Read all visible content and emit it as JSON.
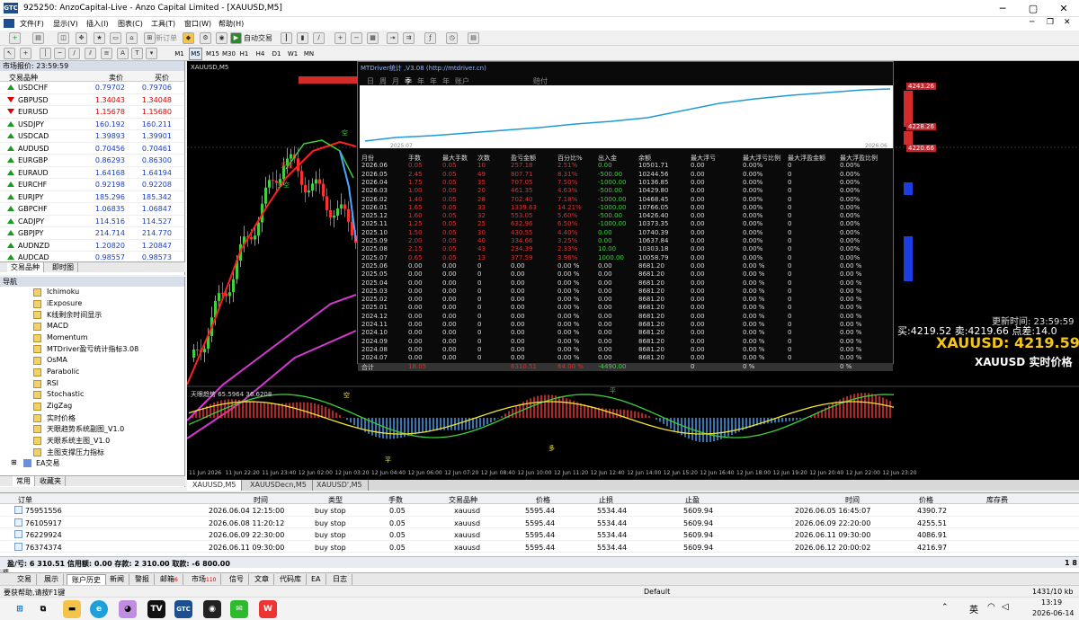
{
  "window": {
    "title": "925250: AnzoCapital-Live - Anzo Capital Limited - [XAUUSD,M5]",
    "logo": "GTC"
  },
  "menu": [
    "文件(F)",
    "显示(V)",
    "插入(I)",
    "图表(C)",
    "工具(T)",
    "窗口(W)",
    "帮助(H)"
  ],
  "toolbar": {
    "new_order": "新订单",
    "auto_trade": "自动交易"
  },
  "timeframes": [
    "M1",
    "M5",
    "M15",
    "M30",
    "H1",
    "H4",
    "D1",
    "W1",
    "MN"
  ],
  "market_watch": {
    "header": "市场报价: 23:59:59",
    "columns": [
      "交易品种",
      "卖价",
      "买价"
    ],
    "rows": [
      {
        "symbol": "USDCHF",
        "bid": "0.79702",
        "ask": "0.79706",
        "dir": "up"
      },
      {
        "symbol": "GBPUSD",
        "bid": "1.34043",
        "ask": "1.34048",
        "dir": "dn"
      },
      {
        "symbol": "EURUSD",
        "bid": "1.15678",
        "ask": "1.15680",
        "dir": "dn"
      },
      {
        "symbol": "USDJPY",
        "bid": "160.192",
        "ask": "160.211",
        "dir": "up"
      },
      {
        "symbol": "USDCAD",
        "bid": "1.39893",
        "ask": "1.39901",
        "dir": "up"
      },
      {
        "symbol": "AUDUSD",
        "bid": "0.70456",
        "ask": "0.70461",
        "dir": "up"
      },
      {
        "symbol": "EURGBP",
        "bid": "0.86293",
        "ask": "0.86300",
        "dir": "up"
      },
      {
        "symbol": "EURAUD",
        "bid": "1.64168",
        "ask": "1.64194",
        "dir": "up"
      },
      {
        "symbol": "EURCHF",
        "bid": "0.92198",
        "ask": "0.92208",
        "dir": "up"
      },
      {
        "symbol": "EURJPY",
        "bid": "185.296",
        "ask": "185.342",
        "dir": "up"
      },
      {
        "symbol": "GBPCHF",
        "bid": "1.06835",
        "ask": "1.06847",
        "dir": "up"
      },
      {
        "symbol": "CADJPY",
        "bid": "114.516",
        "ask": "114.527",
        "dir": "up"
      },
      {
        "symbol": "GBPJPY",
        "bid": "214.714",
        "ask": "214.770",
        "dir": "up"
      },
      {
        "symbol": "AUDNZD",
        "bid": "1.20820",
        "ask": "1.20847",
        "dir": "up"
      },
      {
        "symbol": "AUDCAD",
        "bid": "0.98557",
        "ask": "0.98573",
        "dir": "up"
      }
    ],
    "tabs": [
      "交易品种",
      "即时图"
    ]
  },
  "navigator": {
    "header": "导航",
    "items": [
      "Ichimoku",
      "iExposure",
      "K线剩余时间显示",
      "MACD",
      "Momentum",
      "MTDriver盈亏统计指标3.08",
      "OsMA",
      "Parabolic",
      "RSI",
      "Stochastic",
      "ZigZag",
      "实时价格",
      "天眼趋势系统副图_V1.0",
      "天眼系统主图_V1.0",
      "主图支撑压力指标"
    ],
    "group": "EA交易",
    "tabs": [
      "常用",
      "收藏夹"
    ]
  },
  "chart": {
    "symbol_tf": "XAUUSD,M5",
    "indicator_label": "天眼趋势 65.5964 36.6208",
    "update_time": "更新时间: 23:59:59",
    "bid_line": "买:4219.52  卖:4219.66  点差:14.0",
    "big_price": "XAUUSD: 4219.59",
    "price_caption": "XAUUSD 实时价格",
    "price_labels": [
      "4243.26",
      "4228.26",
      "4220.66"
    ],
    "signal_labels": [
      "多空",
      "多空",
      "空",
      "多",
      "空",
      "平",
      "平"
    ],
    "time_labels": [
      "11 Jun 2026",
      "11 Jun 22:20",
      "11 Jun 23:40",
      "12 Jun 02:00",
      "12 Jun 03:20",
      "12 Jun 04:40",
      "12 Jun 06:00",
      "12 Jun 07:20",
      "12 Jun 08:40",
      "12 Jun 10:00",
      "12 Jun 11:20",
      "12 Jun 12:40",
      "12 Jun 14:00",
      "12 Jun 15:20",
      "12 Jun 16:40",
      "12 Jun 18:00",
      "12 Jun 19:20",
      "12 Jun 20:40",
      "12 Jun 22:00",
      "12 Jun 23:20"
    ],
    "tabs": [
      "XAUUSD,M5",
      "XAUUSDecn,M5",
      "XAUUSD',M5"
    ]
  },
  "stats": {
    "title": "MTDriver统计 ,V3.08 (http://mtdriver.cn)",
    "periods": [
      "日",
      "周",
      "月",
      "季",
      "年",
      "年",
      "年",
      "账户"
    ],
    "range_label": "赔付",
    "start": "2025.07",
    "end": "2026.06",
    "columns": [
      "月份",
      "手数",
      "最大手数",
      "次数",
      "盈亏金额",
      "百分比%",
      "出入金",
      "余额",
      "最大浮亏",
      "最大浮亏比例",
      "最大浮盈金额",
      "最大浮盈比例"
    ],
    "rows": [
      [
        "2026.06",
        "0.05",
        "0.05",
        "10",
        "257.18",
        "2.51%",
        "0.00",
        "10501.71",
        "0.00",
        "0.00%",
        "0",
        "0.00%"
      ],
      [
        "2026.05",
        "2.45",
        "0.05",
        "49",
        "807.71",
        "8.31%",
        "-500.00",
        "10244.56",
        "0.00",
        "0.00%",
        "0",
        "0.00%"
      ],
      [
        "2026.04",
        "1.75",
        "0.05",
        "35",
        "707.05",
        "7.50%",
        "-1000.00",
        "10136.85",
        "0.00",
        "0.00%",
        "0",
        "0.00%"
      ],
      [
        "2026.03",
        "1.00",
        "0.05",
        "20",
        "461.35",
        "4.63%",
        "-500.00",
        "10429.80",
        "0.00",
        "0.00%",
        "0",
        "0.00%"
      ],
      [
        "2026.02",
        "1.40",
        "0.05",
        "28",
        "702.40",
        "7.18%",
        "-1000.00",
        "10468.45",
        "0.00",
        "0.00%",
        "0",
        "0.00%"
      ],
      [
        "2026.01",
        "1.65",
        "0.05",
        "33",
        "1339.63",
        "14.21%",
        "-1000.00",
        "10766.05",
        "0.00",
        "0.00%",
        "0",
        "0.00%"
      ],
      [
        "2025.12",
        "1.60",
        "0.05",
        "32",
        "553.05",
        "5.60%",
        "-500.00",
        "10426.40",
        "0.00",
        "0.00%",
        "0",
        "0.00%"
      ],
      [
        "2025.11",
        "1.25",
        "0.05",
        "25",
        "632.96",
        "6.50%",
        "-1000.00",
        "10373.35",
        "0.00",
        "0.00%",
        "0",
        "0.00%"
      ],
      [
        "2025.10",
        "1.50",
        "0.05",
        "30",
        "430.55",
        "4.40%",
        "0.00",
        "10740.39",
        "0.00",
        "0.00%",
        "0",
        "0.00%"
      ],
      [
        "2025.09",
        "2.00",
        "0.05",
        "40",
        "334.66",
        "3.25%",
        "0.00",
        "10637.84",
        "0.00",
        "0.00%",
        "0",
        "0.00%"
      ],
      [
        "2025.08",
        "2.15",
        "0.05",
        "43",
        "234.39",
        "2.33%",
        "10.00",
        "10303.18",
        "0.00",
        "0.00%",
        "0",
        "0.00%"
      ],
      [
        "2025.07",
        "0.65",
        "0.05",
        "13",
        "377.59",
        "3.96%",
        "1000.00",
        "10058.79",
        "0.00",
        "0.00%",
        "0",
        "0.00%"
      ],
      [
        "2025.06",
        "0.00",
        "0.00",
        "0",
        "0.00",
        "0.00 %",
        "0.00",
        "8681.20",
        "0.00",
        "0.00 %",
        "0",
        "0.00 %"
      ],
      [
        "2025.05",
        "0.00",
        "0.00",
        "0",
        "0.00",
        "0.00 %",
        "0.00",
        "8681.20",
        "0.00",
        "0.00 %",
        "0",
        "0.00 %"
      ],
      [
        "2025.04",
        "0.00",
        "0.00",
        "0",
        "0.00",
        "0.00 %",
        "0.00",
        "8681.20",
        "0.00",
        "0.00 %",
        "0",
        "0.00 %"
      ],
      [
        "2025.03",
        "0.00",
        "0.00",
        "0",
        "0.00",
        "0.00 %",
        "0.00",
        "8681.20",
        "0.00",
        "0.00 %",
        "0",
        "0.00 %"
      ],
      [
        "2025.02",
        "0.00",
        "0.00",
        "0",
        "0.00",
        "0.00 %",
        "0.00",
        "8681.20",
        "0.00",
        "0.00 %",
        "0",
        "0.00 %"
      ],
      [
        "2025.01",
        "0.00",
        "0.00",
        "0",
        "0.00",
        "0.00 %",
        "0.00",
        "8681.20",
        "0.00",
        "0.00 %",
        "0",
        "0.00 %"
      ],
      [
        "2024.12",
        "0.00",
        "0.00",
        "0",
        "0.00",
        "0.00 %",
        "0.00",
        "8681.20",
        "0.00",
        "0.00 %",
        "0",
        "0.00 %"
      ],
      [
        "2024.11",
        "0.00",
        "0.00",
        "0",
        "0.00",
        "0.00 %",
        "0.00",
        "8681.20",
        "0.00",
        "0.00 %",
        "0",
        "0.00 %"
      ],
      [
        "2024.10",
        "0.00",
        "0.00",
        "0",
        "0.00",
        "0.00 %",
        "0.00",
        "8681.20",
        "0.00",
        "0.00 %",
        "0",
        "0.00 %"
      ],
      [
        "2024.09",
        "0.00",
        "0.00",
        "0",
        "0.00",
        "0.00 %",
        "0.00",
        "8681.20",
        "0.00",
        "0.00 %",
        "0",
        "0.00 %"
      ],
      [
        "2024.08",
        "0.00",
        "0.00",
        "0",
        "0.00",
        "0.00 %",
        "0.00",
        "8681.20",
        "0.00",
        "0.00 %",
        "0",
        "0.00 %"
      ],
      [
        "2024.07",
        "0.00",
        "0.00",
        "0",
        "0.00",
        "0.00 %",
        "0.00",
        "8681.20",
        "0.00",
        "0.00 %",
        "0",
        "0.00 %"
      ]
    ],
    "total": [
      "合计",
      "18.05",
      "",
      "",
      "6310.51",
      "64.00 %",
      "-4490.00",
      "",
      "0",
      "0 %",
      "",
      "0 %"
    ]
  },
  "terminal": {
    "columns": [
      "订单",
      "时间",
      "类型",
      "手数",
      "交易品种",
      "价格",
      "止损",
      "止盈",
      "时间",
      "价格",
      "库存费"
    ],
    "rows": [
      [
        "75951556",
        "2026.06.04 12:15:00",
        "buy stop",
        "0.05",
        "xauusd",
        "5595.44",
        "5534.44",
        "5609.94",
        "2026.06.05 16:45:07",
        "4390.72",
        ""
      ],
      [
        "76105917",
        "2026.06.08 11:20:12",
        "buy stop",
        "0.05",
        "xauusd",
        "5595.44",
        "5534.44",
        "5609.94",
        "2026.06.09 22:20:00",
        "4255.51",
        ""
      ],
      [
        "76229924",
        "2026.06.09 22:30:00",
        "buy stop",
        "0.05",
        "xauusd",
        "5595.44",
        "5534.44",
        "5609.94",
        "2026.06.11 09:30:00",
        "4086.91",
        ""
      ],
      [
        "76374374",
        "2026.06.11 09:30:00",
        "buy stop",
        "0.05",
        "xauusd",
        "5595.44",
        "5534.44",
        "5609.94",
        "2026.06.12 20:00:02",
        "4216.97",
        ""
      ]
    ],
    "summary": "盈/亏: 6 310.51  信用额: 0.00  存款: 2 310.00  取款: -6 800.00",
    "summary_right": "1 8",
    "tabs": [
      "交易",
      "展示",
      "账户历史",
      "新闻",
      "警报",
      "邮箱",
      "市场",
      "信号",
      "文章",
      "代码库",
      "EA",
      "日志"
    ],
    "tab_badges": {
      "mail": "6",
      "market": "110"
    },
    "side_label": "终端"
  },
  "statusbar": {
    "help": "要获帮助,请按F1键",
    "profile": "Default",
    "traffic": "1431/10 kb"
  },
  "taskbar": {
    "time": "13:19",
    "date": "2026-06-14",
    "lang": "英"
  }
}
